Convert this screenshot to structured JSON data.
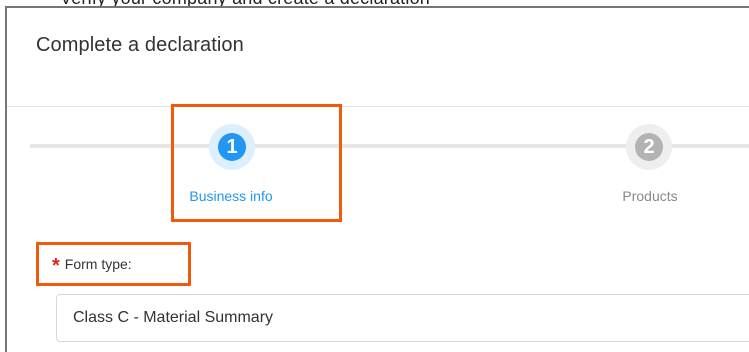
{
  "top_cropped_text": "Verify your company and create a declaration",
  "dialog": {
    "title": "Complete a declaration"
  },
  "stepper": {
    "steps": [
      {
        "number": "1",
        "label": "Business info",
        "state": "active"
      },
      {
        "number": "2",
        "label": "Products",
        "state": "inactive"
      }
    ]
  },
  "form": {
    "form_type_label": "Form type:",
    "required_marker": "*",
    "form_type_value": "Class C - Material Summary"
  },
  "colors": {
    "accent": "#2196f3",
    "highlight": "#f05a0a",
    "required": "#e52020",
    "inactive_step": "#b3b3b3"
  }
}
